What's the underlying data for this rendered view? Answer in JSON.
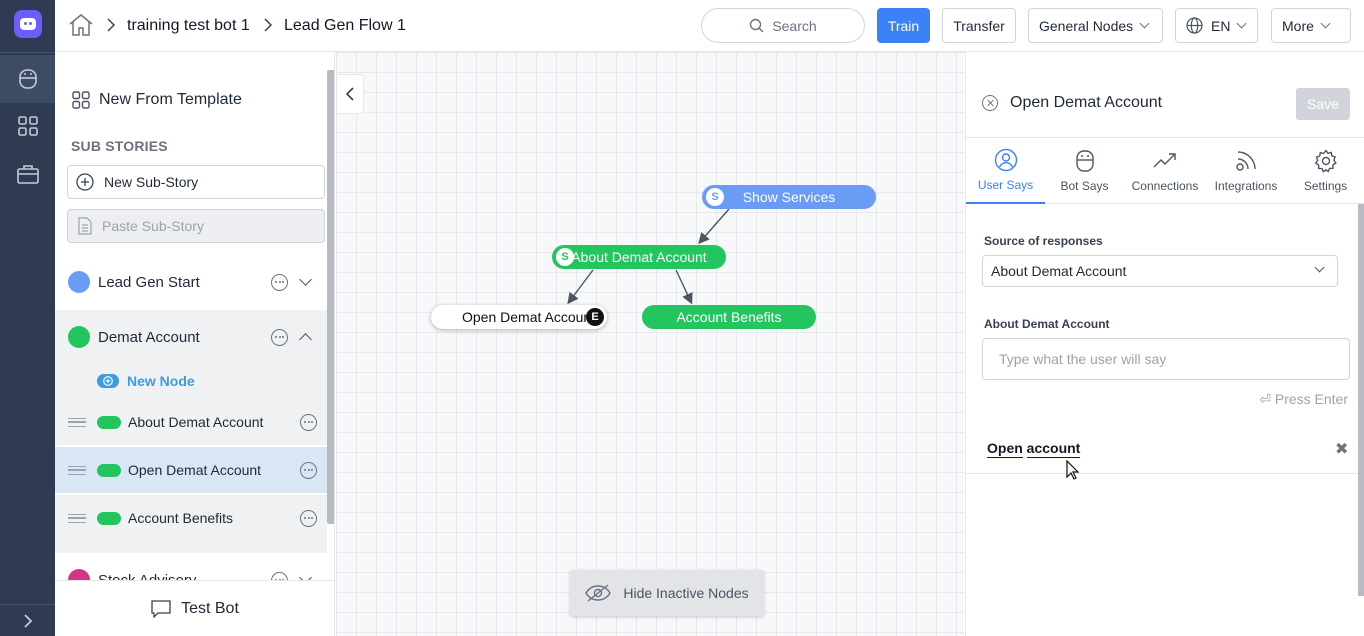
{
  "colors": {
    "rail_bg": "#2f3b52",
    "accent_blue": "#3b82f6",
    "node_blue": "#6b9cf5",
    "node_green": "#22c55e",
    "lead_gen_dot": "#6b9cf5",
    "demat_dot": "#22c55e",
    "stock_dot": "#d63384"
  },
  "icons": {
    "rail": [
      "bot-logo-icon",
      "bot-icon",
      "apps-grid-icon",
      "briefcase-icon",
      "chevron-right-icon"
    ]
  },
  "breadcrumb": {
    "bot": "training test bot 1",
    "flow": "Lead Gen Flow 1"
  },
  "toolbar": {
    "search_placeholder": "Search",
    "train": "Train",
    "transfer": "Transfer",
    "general_nodes": "General Nodes",
    "language": "EN",
    "more": "More"
  },
  "left_panel": {
    "new_from_template": "New From Template",
    "sub_stories_heading": "SUB STORIES",
    "new_sub_story": "New Sub-Story",
    "paste_sub_story": "Paste Sub-Story",
    "groups": [
      {
        "label": "Lead Gen Start",
        "expanded": false
      },
      {
        "label": "Demat Account",
        "expanded": true
      },
      {
        "label": "Stock Advisory",
        "expanded": false
      }
    ],
    "new_node": "New Node",
    "nodes": [
      {
        "label": "About Demat Account",
        "selected": false
      },
      {
        "label": "Open Demat Account",
        "selected": true
      },
      {
        "label": "Account Benefits",
        "selected": false
      }
    ],
    "test_bot": "Test Bot"
  },
  "canvas": {
    "nodes": {
      "show_services": {
        "label": "Show Services",
        "badge": "S"
      },
      "about_demat": {
        "label": "About Demat Account",
        "badge": "S"
      },
      "open_demat": {
        "label": "Open Demat Account",
        "badge": "E"
      },
      "account_benefits": {
        "label": "Account Benefits"
      }
    },
    "hide_inactive": "Hide Inactive Nodes"
  },
  "right_panel": {
    "title": "Open Demat Account",
    "save": "Save",
    "tabs": [
      {
        "label": "User Says",
        "active": true
      },
      {
        "label": "Bot Says",
        "active": false
      },
      {
        "label": "Connections",
        "active": false
      },
      {
        "label": "Integrations",
        "active": false
      },
      {
        "label": "Settings",
        "active": false
      }
    ],
    "source_label": "Source of responses",
    "source_value": "About Demat Account",
    "input_label": "About Demat Account",
    "input_placeholder": "Type what the user will say",
    "press_enter": "⏎ Press Enter",
    "utterance": [
      "Open",
      "account"
    ]
  }
}
